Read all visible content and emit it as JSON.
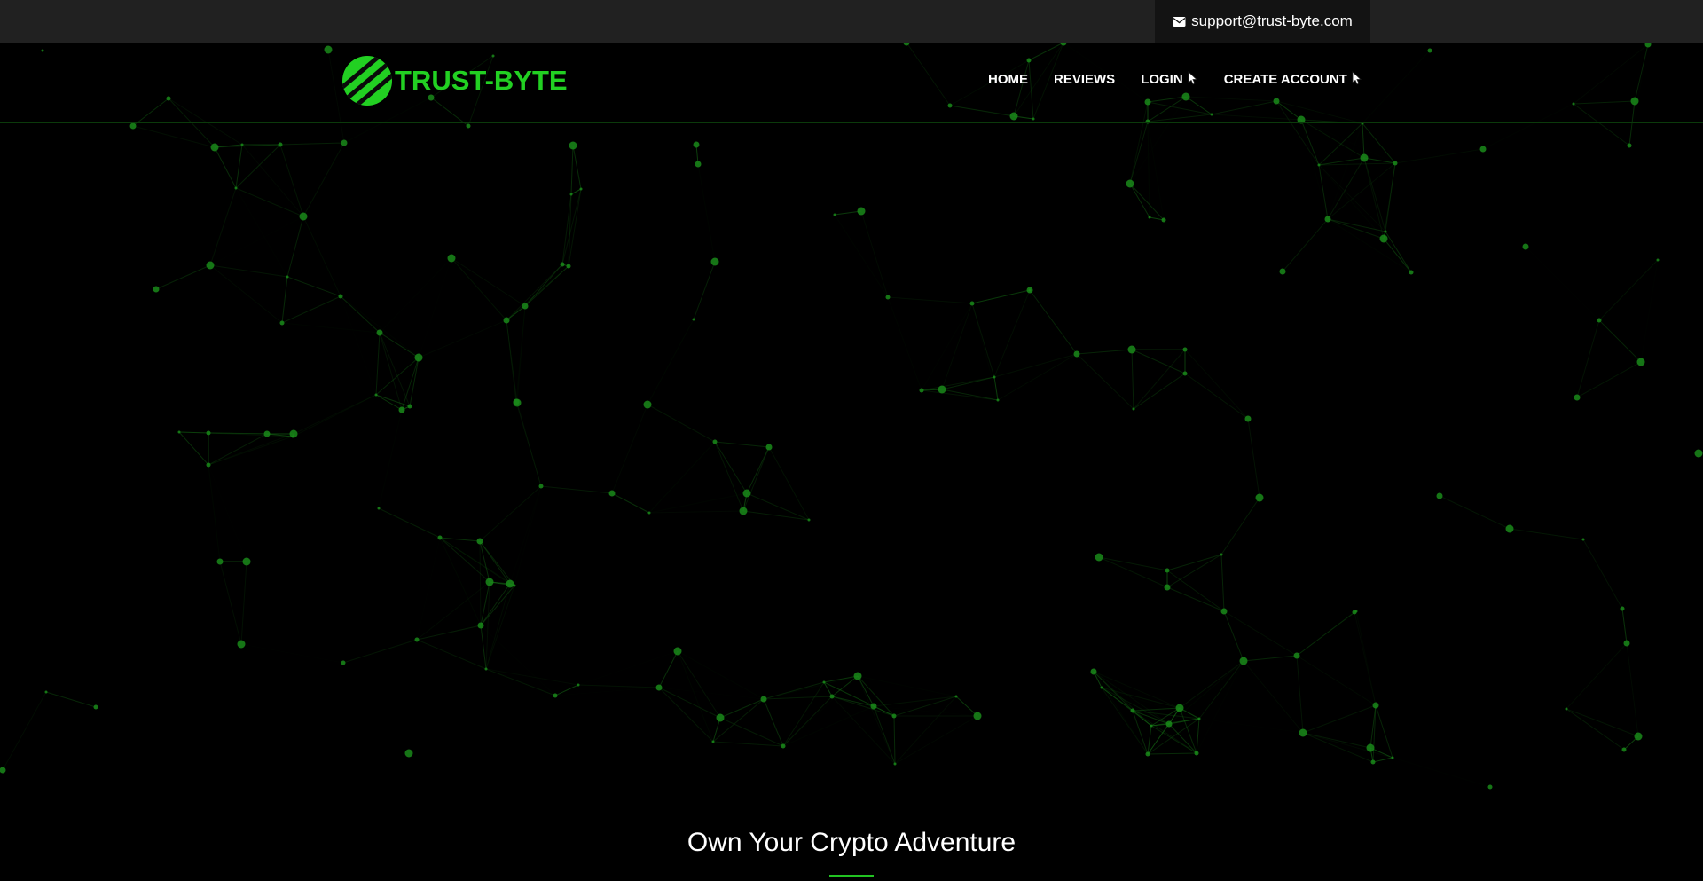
{
  "topbar": {
    "support_email": "support@trust-byte.com",
    "support_icon": "envelope-icon"
  },
  "logo": {
    "text": "TRUST-BYTE",
    "color": "#22d022"
  },
  "nav": {
    "items": [
      {
        "label": "HOME"
      },
      {
        "label": "REVIEWS"
      },
      {
        "label": "LOGIN",
        "icon": "cursor-icon"
      },
      {
        "label": "CREATE ACCOUNT",
        "icon": "cursor-icon"
      }
    ]
  },
  "hero": {
    "title": "Own Your Crypto Adventure",
    "accent_color": "#22c322",
    "background_color": "#000000",
    "network_color": "#1a8a1a"
  }
}
